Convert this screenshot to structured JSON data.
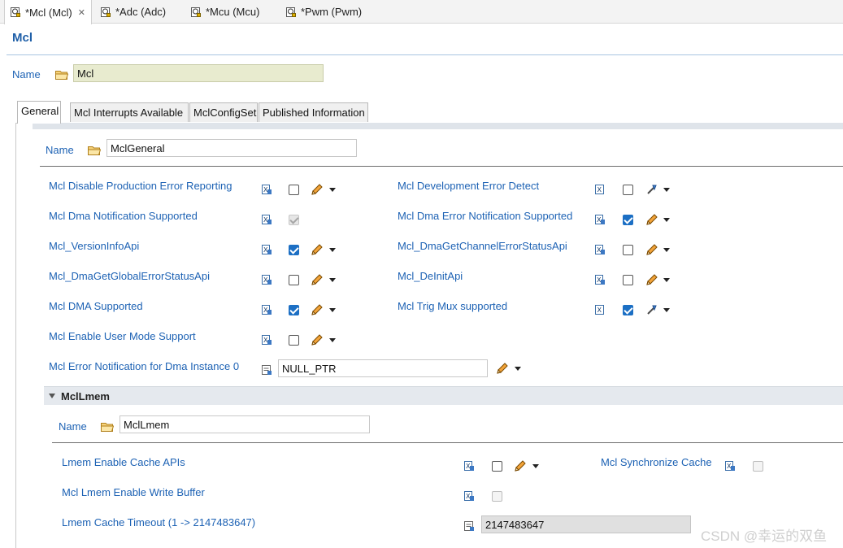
{
  "editor_tabs": [
    {
      "label": "*Mcl (Mcl)",
      "active": true,
      "closable": true
    },
    {
      "label": "*Adc (Adc)",
      "active": false
    },
    {
      "label": "*Mcu (Mcu)",
      "active": false
    },
    {
      "label": "*Pwm (Pwm)",
      "active": false
    }
  ],
  "page": {
    "title": "Mcl",
    "name_label": "Name",
    "name_value": "Mcl"
  },
  "inner_tabs": [
    "General",
    "Mcl Interrupts Available",
    "MclConfigSet",
    "Published Information"
  ],
  "general": {
    "name_label": "Name",
    "name_value": "MclGeneral",
    "params": [
      {
        "label": "Mcl Disable Production Error Reporting",
        "checked": false,
        "icon": "pencil-icon"
      },
      {
        "label": "Mcl Development Error Detect",
        "checked": false,
        "icon": "wand-icon"
      },
      {
        "label": "Mcl Dma Notification Supported",
        "checked": true,
        "disabled": true
      },
      {
        "label": "Mcl Dma Error Notification Supported",
        "checked": true,
        "icon": "pencil-icon"
      },
      {
        "label": "Mcl_VersionInfoApi",
        "checked": true,
        "icon": "pencil-icon"
      },
      {
        "label": "Mcl_DmaGetChannelErrorStatusApi",
        "checked": false,
        "icon": "pencil-icon"
      },
      {
        "label": "Mcl_DmaGetGlobalErrorStatusApi",
        "checked": false,
        "icon": "pencil-icon"
      },
      {
        "label": "Mcl_DeInitApi",
        "checked": false,
        "icon": "pencil-icon"
      },
      {
        "label": "Mcl DMA Supported",
        "checked": true,
        "icon": "pencil-icon"
      },
      {
        "label": "Mcl Trig Mux supported",
        "checked": true,
        "icon": "wand-icon"
      },
      {
        "label": "Mcl Enable User Mode Support",
        "checked": false,
        "icon": "pencil-icon"
      }
    ],
    "error_notification": {
      "label": "Mcl Error Notification for Dma Instance 0",
      "value": "NULL_PTR"
    }
  },
  "lmem": {
    "title": "MclLmem",
    "name_label": "Name",
    "name_value": "MclLmem",
    "params": [
      {
        "label": "Lmem Enable Cache APIs",
        "checked": false,
        "icon": "pencil-icon"
      },
      {
        "label": "Mcl Synchronize Cache",
        "checked": false,
        "disabled": true
      },
      {
        "label": "Mcl Lmem Enable Write Buffer",
        "checked": false,
        "disabled": true
      }
    ],
    "timeout": {
      "label": "Lmem Cache Timeout (1 -> 2147483647)",
      "value": "2147483647"
    }
  },
  "watermark": "CSDN @幸运的双鱼",
  "colors": {
    "link_blue": "#1d62b4",
    "check_blue": "#1c6fc4",
    "title_blue": "#1f5fa8"
  }
}
